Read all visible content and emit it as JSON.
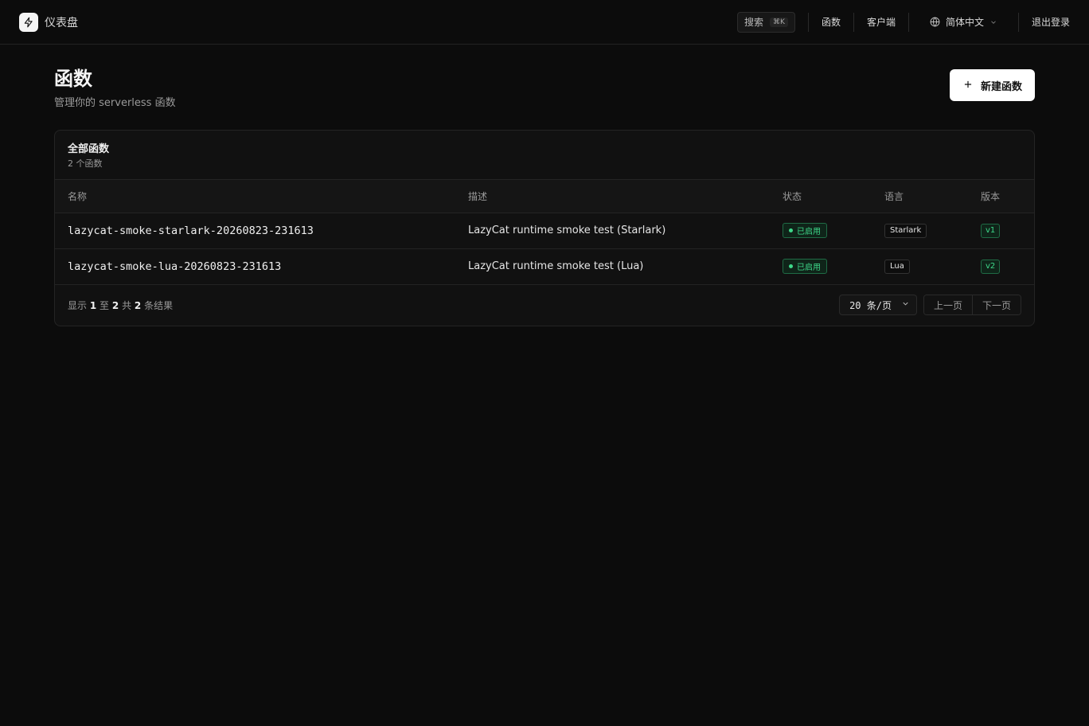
{
  "app": {
    "title": "仪表盘"
  },
  "nav": {
    "search_label": "搜索",
    "search_shortcut": "⌘K",
    "functions_link": "函数",
    "clients_link": "客户端",
    "language": "简体中文",
    "logout": "退出登录"
  },
  "page": {
    "title": "函数",
    "subtitle": "管理你的 serverless 函数",
    "new_button": "新建函数"
  },
  "card": {
    "title": "全部函数",
    "subtitle": "2 个函数"
  },
  "table": {
    "headers": {
      "name": "名称",
      "description": "描述",
      "status": "状态",
      "language": "语言",
      "version": "版本"
    },
    "rows": [
      {
        "name": "lazycat-smoke-starlark-20260823-231613",
        "description": "LazyCat runtime smoke test (Starlark)",
        "status": "已启用",
        "language": "Starlark",
        "version": "v1"
      },
      {
        "name": "lazycat-smoke-lua-20260823-231613",
        "description": "LazyCat runtime smoke test (Lua)",
        "status": "已启用",
        "language": "Lua",
        "version": "v2"
      }
    ]
  },
  "footer": {
    "results_prefix": "显示",
    "from": "1",
    "to_word": "至",
    "to": "2",
    "total_word": "共",
    "total": "2",
    "results_suffix": "条结果",
    "page_size": "20 条/页",
    "prev": "上一页",
    "next": "下一页"
  },
  "colors": {
    "background": "#0c0c0c",
    "status_green": "#3ed88a",
    "primary_button": "#ffffff"
  },
  "icons": {
    "brand": "lightning-bolt-icon",
    "language": "globe-icon",
    "dropdown": "chevron-down-icon",
    "new": "plus-icon"
  }
}
